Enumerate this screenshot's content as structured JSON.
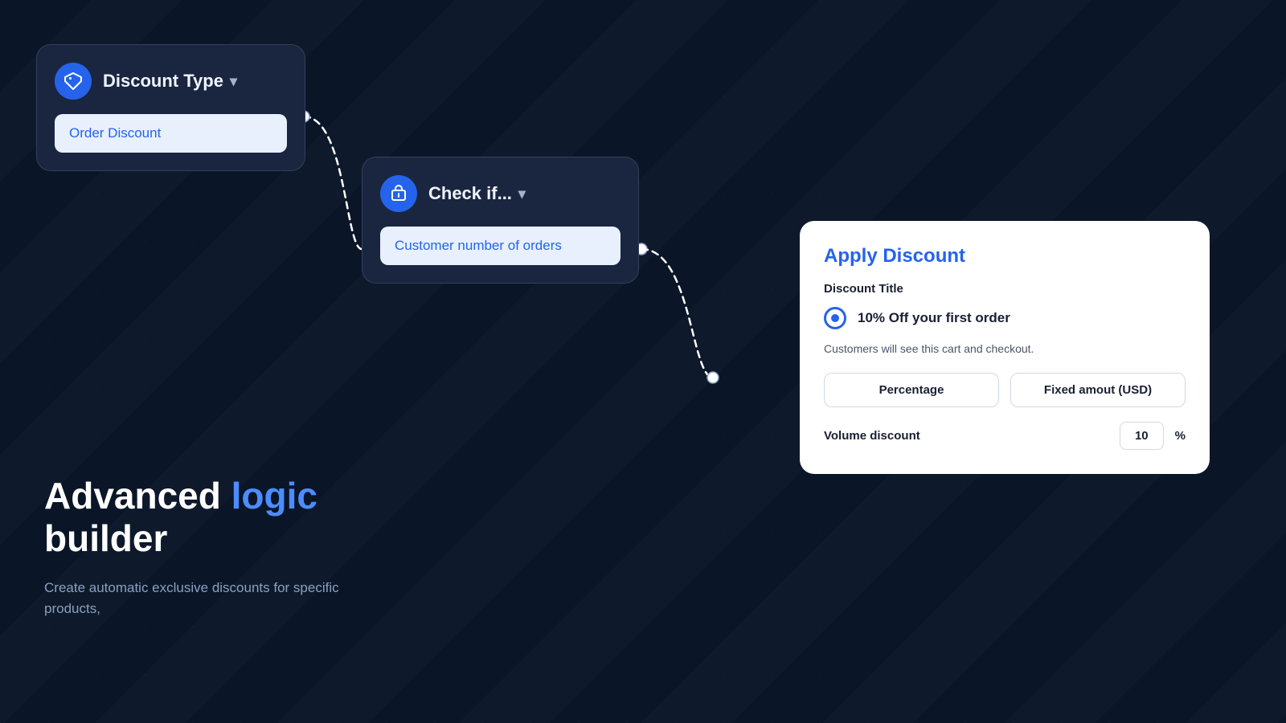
{
  "card1": {
    "title": "Discount Type",
    "chevron": "▾",
    "option": "Order Discount"
  },
  "card2": {
    "title": "Check if...",
    "chevron": "▾",
    "option": "Customer number of orders"
  },
  "card3": {
    "title": "Apply Discount",
    "discount_title_label": "Discount Title",
    "radio_label": "10% Off your first order",
    "cart_checkout_text": "Customers will see this cart and checkout.",
    "option1": "Percentage",
    "option2": "Fixed amout (USD)",
    "volume_label": "Volume discount",
    "volume_value": "10",
    "volume_percent": "%"
  },
  "bottom": {
    "headline_normal": "Advanced ",
    "headline_highlight": "logic",
    "headline_line2": "builder",
    "subtext": "Create automatic exclusive discounts for specific products,"
  }
}
